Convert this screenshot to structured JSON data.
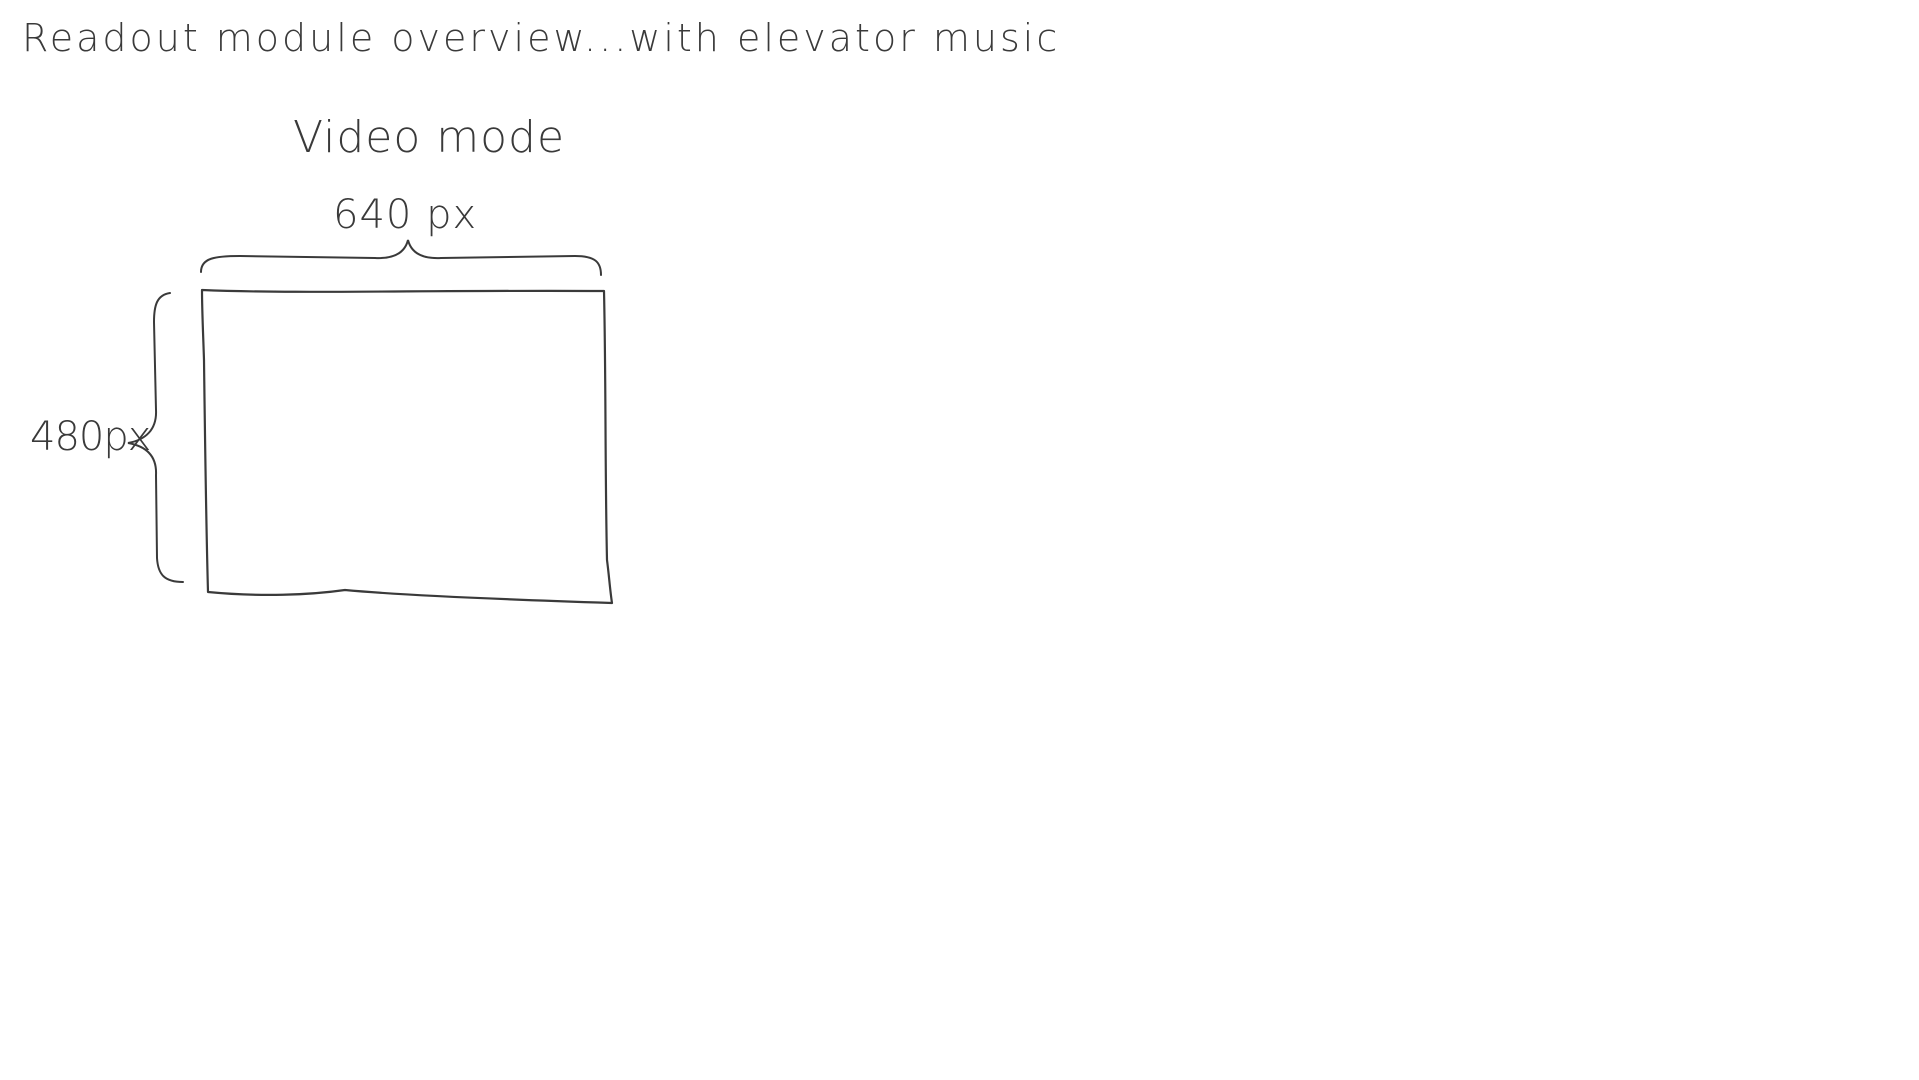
{
  "page": {
    "title": "Readout module overview...with elevator music"
  },
  "diagram": {
    "section_title": "Video mode",
    "frame": {
      "width_label": "640 px",
      "height_label": "480px"
    }
  },
  "colors": {
    "background": "#ffffff",
    "ink": "#3a3a3a"
  }
}
